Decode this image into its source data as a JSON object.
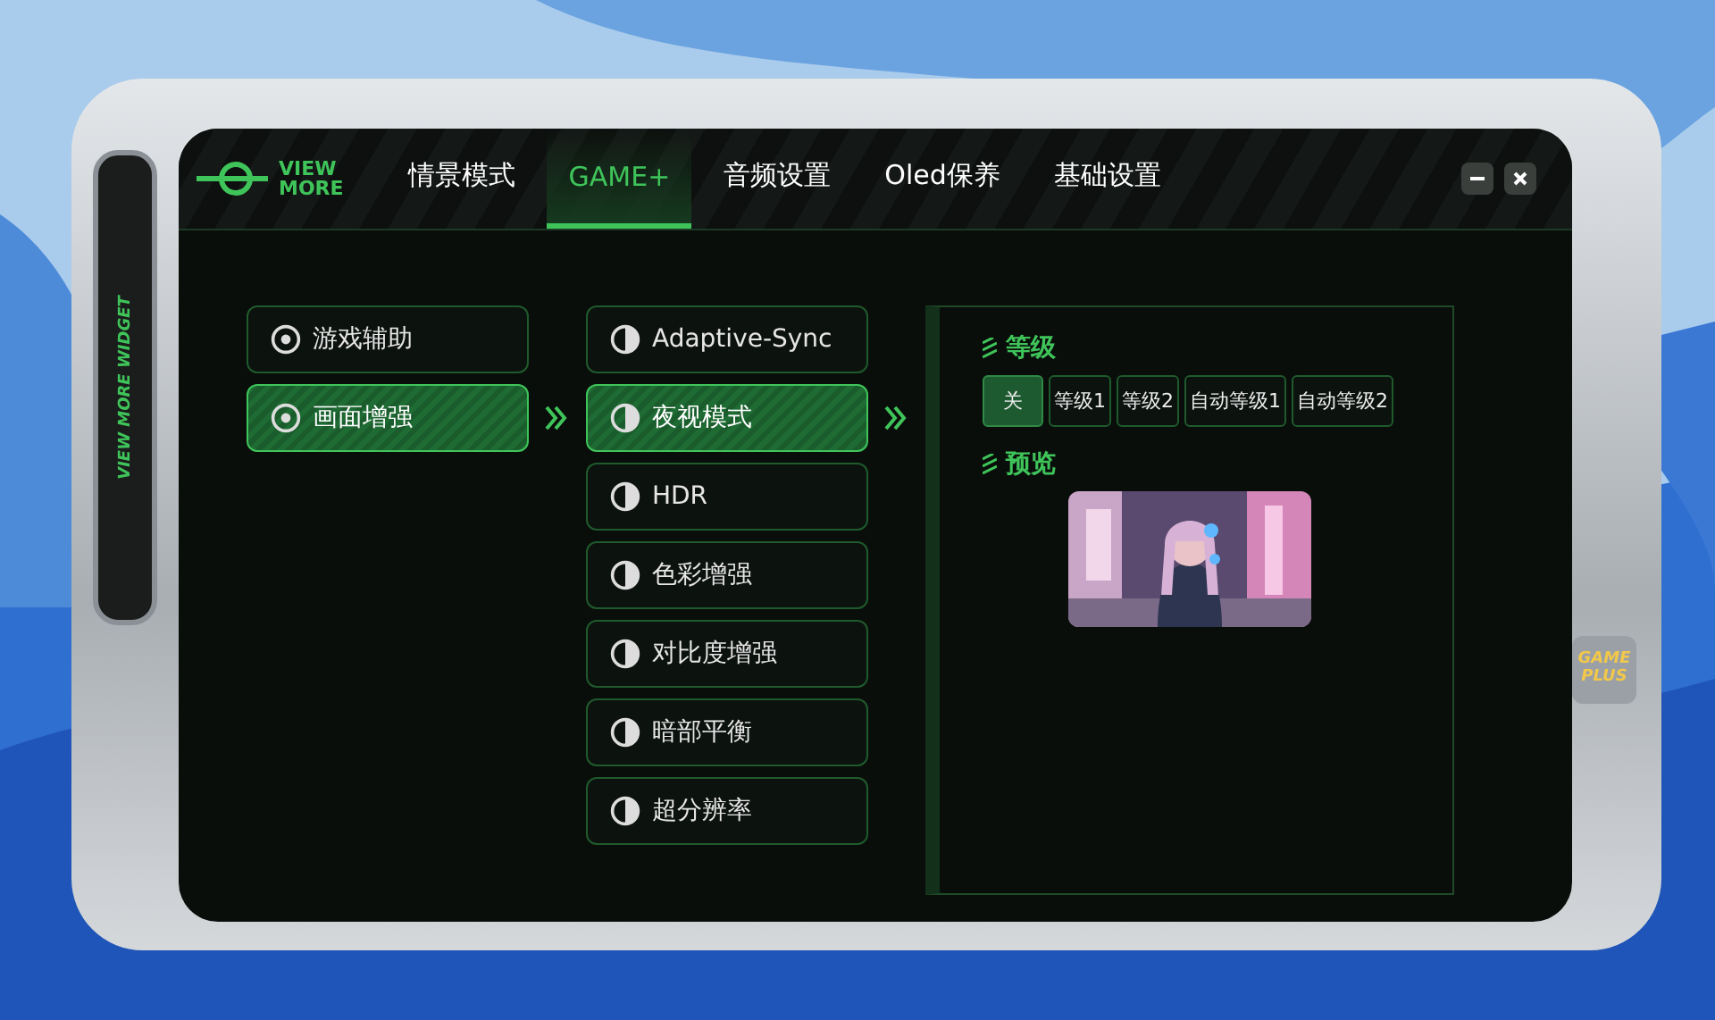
{
  "window": {
    "side_label": "VIEW MORE WIDGET",
    "badge": {
      "line_1": "GAME",
      "line_2": "PLUS"
    }
  },
  "logo": {
    "line_1": "VIEW",
    "line_2": "MORE"
  },
  "tabs": [
    {
      "label": "情景模式",
      "selected": false
    },
    {
      "label": "GAME+",
      "selected": true
    },
    {
      "label": "音频设置",
      "selected": false
    },
    {
      "label": "Oled保养",
      "selected": false
    },
    {
      "label": "基础设置",
      "selected": false
    }
  ],
  "categories": [
    {
      "label": "游戏辅助",
      "selected": false
    },
    {
      "label": "画面增强",
      "selected": true
    }
  ],
  "features": [
    {
      "label": "Adaptive-Sync",
      "selected": false
    },
    {
      "label": "夜视模式",
      "selected": true
    },
    {
      "label": "HDR",
      "selected": false
    },
    {
      "label": "色彩增强",
      "selected": false
    },
    {
      "label": "对比度增强",
      "selected": false
    },
    {
      "label": "暗部平衡",
      "selected": false
    },
    {
      "label": "超分辨率",
      "selected": false
    }
  ],
  "settings": {
    "level_heading": "等级",
    "levels": [
      {
        "label": "关",
        "selected": true
      },
      {
        "label": "等级1",
        "selected": false
      },
      {
        "label": "等级2",
        "selected": false
      },
      {
        "label": "自动等级1",
        "selected": false
      },
      {
        "label": "自动等级2",
        "selected": false
      }
    ],
    "preview_heading": "预览"
  }
}
